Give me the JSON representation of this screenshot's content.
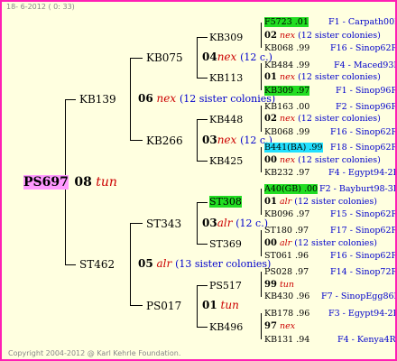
{
  "header": "18-  6-2012 ( 0: 33)",
  "copyright": "Copyright 2004-2012 @ Karl Kehrle Foundation.",
  "root": {
    "name": "PS697",
    "year": "08",
    "note": "tun"
  },
  "gen1": [
    {
      "name": "KB139",
      "year": "06",
      "note": "nex",
      "sisters": "(12 sister colonies)"
    },
    {
      "name": "ST462",
      "year": "05",
      "note": "alr",
      "sisters": "(13 sister colonies)"
    }
  ],
  "gen2": [
    {
      "name": "KB075",
      "year": "04",
      "note": "nex",
      "sisters": "(12 c.)"
    },
    {
      "name": "KB266",
      "year": "03",
      "note": "nex",
      "sisters": "(12 c.)"
    },
    {
      "name": "ST343",
      "year": "03",
      "note": "alr",
      "sisters": "(12 c.)"
    },
    {
      "name": "PS017",
      "year": "01",
      "note": "tun",
      "sisters": ""
    }
  ],
  "gen3": [
    {
      "name": "KB309",
      "year": "02",
      "note": "nex",
      "sisters": "(12 sister colonies)"
    },
    {
      "name": "KB113",
      "year": "01",
      "note": "nex",
      "sisters": "(12 sister colonies)"
    },
    {
      "name": "KB448",
      "year": "02",
      "note": "nex",
      "sisters": "(12 sister colonies)"
    },
    {
      "name": "KB425",
      "year": "00",
      "note": "nex",
      "sisters": "(12 sister colonies)"
    },
    {
      "name": "ST308",
      "year": "01",
      "note": "alr",
      "sisters": "(12 sister colonies)"
    },
    {
      "name": "ST369",
      "year": "00",
      "note": "alr",
      "sisters": "(12 sister colonies)"
    },
    {
      "name": "PS517",
      "year": "99",
      "note": "tun",
      "sisters": ""
    },
    {
      "name": "KB496",
      "year": "97",
      "note": "nex",
      "sisters": ""
    }
  ],
  "gen4": [
    {
      "name": "F5723 .01",
      "right": "F1 - Carpath00R"
    },
    {
      "name": "KB068 .99",
      "right": "F16 - Sinop62R"
    },
    {
      "name": "KB484 .99",
      "right": "F4 - Maced93R"
    },
    {
      "name": "KB309 .97",
      "right": "F1 - Sinop96R"
    },
    {
      "name": "KB163 .00",
      "right": "F2 - Sinop96R"
    },
    {
      "name": "KB068 .99",
      "right": "F16 - Sinop62R"
    },
    {
      "name": "B441(BA) .99",
      "right": "F18 - Sinop62R"
    },
    {
      "name": "KB232 .97",
      "right": "F4 - Egypt94-2R"
    },
    {
      "name": "A40(GB) .00",
      "right": "F2 - Bayburt98-3R"
    },
    {
      "name": "KB096 .97",
      "right": "F15 - Sinop62R"
    },
    {
      "name": "ST180 .97",
      "right": "F17 - Sinop62R"
    },
    {
      "name": "ST061 .96",
      "right": "F16 - Sinop62R"
    },
    {
      "name": "PS028 .97",
      "right": "F14 - Sinop72R"
    },
    {
      "name": "KB430 .96",
      "right": "F7 - SinopEgg86R"
    },
    {
      "name": "KB178 .96",
      "right": "F3 - Egypt94-2R"
    },
    {
      "name": "KB131 .94",
      "right": "F4 - Kenya4R"
    }
  ]
}
